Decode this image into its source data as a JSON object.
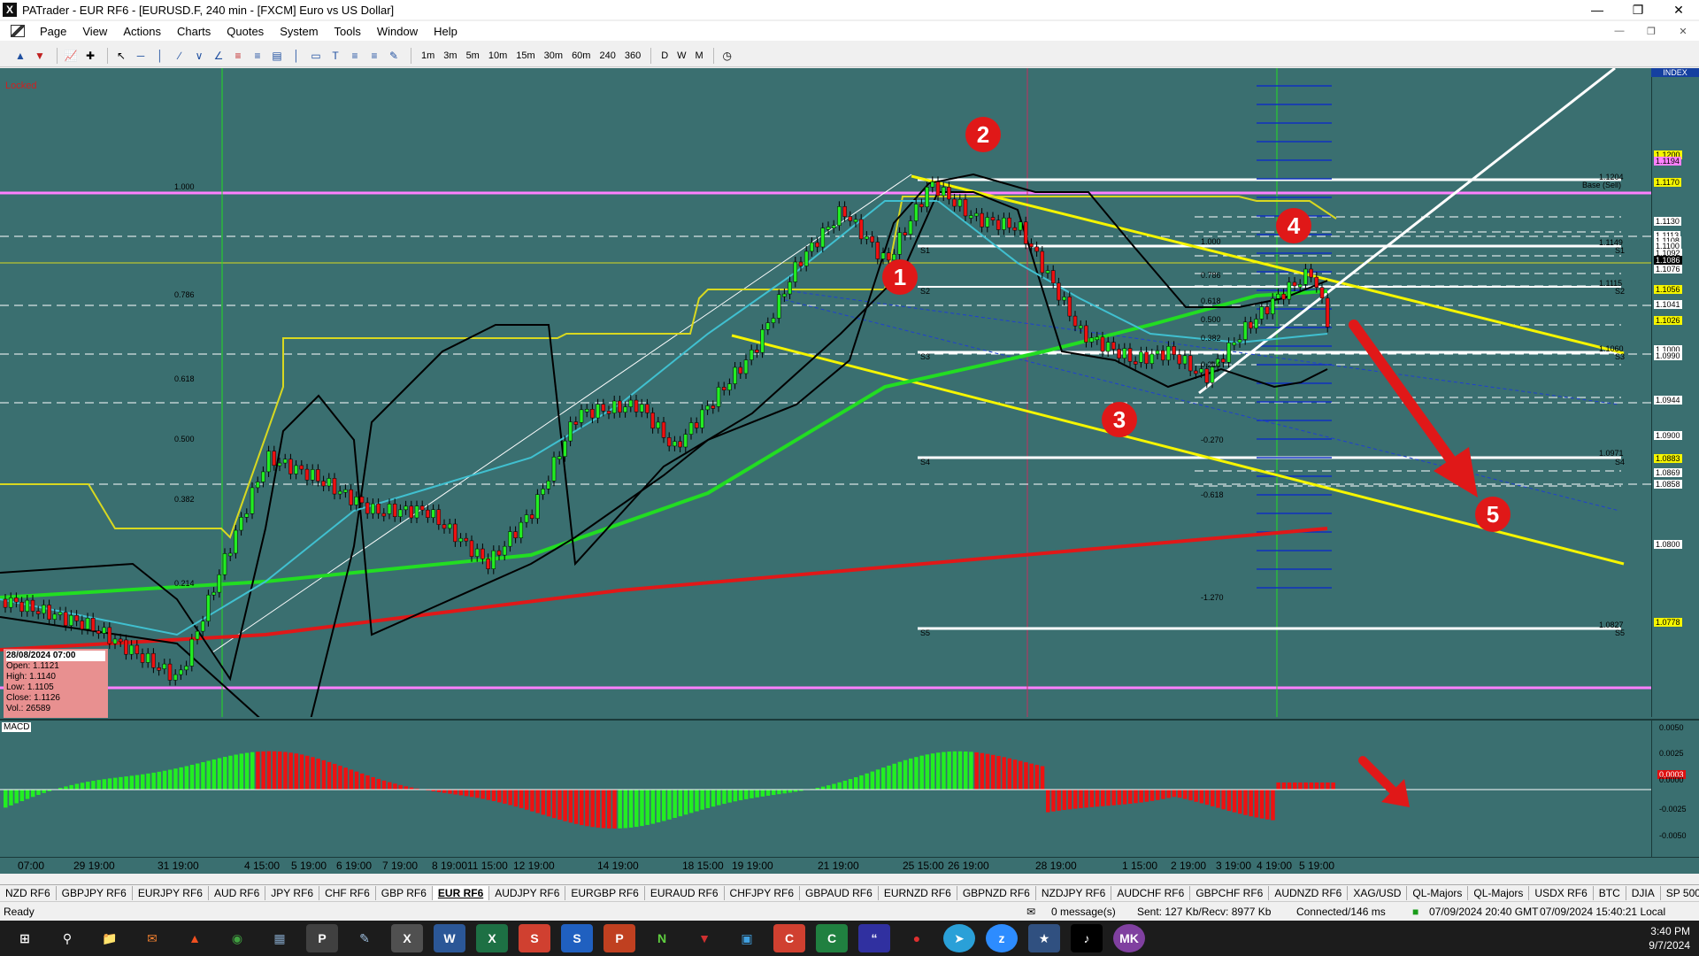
{
  "window": {
    "title": "PATrader - EUR RF6 - [EURUSD.F, 240 min - [FXCM] Euro vs US Dollar]"
  },
  "menu": [
    "Page",
    "View",
    "Actions",
    "Charts",
    "Quotes",
    "System",
    "Tools",
    "Window",
    "Help"
  ],
  "toolbar": {
    "timeframes": [
      "1m",
      "3m",
      "5m",
      "10m",
      "15m",
      "30m",
      "60m",
      "240",
      "360",
      "D",
      "W",
      "M"
    ]
  },
  "chart": {
    "locked_label": "Locked",
    "index_label": "INDEX",
    "macd_label": "MACD",
    "fib_left": [
      "1.000",
      "0.786",
      "0.618",
      "0.500",
      "0.382",
      "0.214"
    ],
    "fib_right": [
      "1.000",
      "0.786",
      "0.618",
      "0.500",
      "0.382",
      "0.214",
      "-0.270",
      "-0.618",
      "-1.270"
    ],
    "pivot_labels": [
      "S1",
      "S2",
      "S3",
      "S4",
      "S5"
    ],
    "right_level_labels": [
      "1.1204",
      "Base (Sell)",
      "1.1149",
      "S1",
      "1.1115",
      "S2",
      "1.1060",
      "S3",
      "1.0971",
      "S4",
      "1.0827",
      "S5"
    ],
    "price_scale": [
      "1.1200",
      "1.1194",
      "1.1170",
      "1.1130",
      "1.1113",
      "1.1108",
      "1.1100",
      "1.1092",
      "1.1086",
      "1.1076",
      "1.1056",
      "1.1041",
      "1.1026",
      "1.1000",
      "1.0990",
      "1.0944",
      "1.0900",
      "1.0883",
      "1.0869",
      "1.0858",
      "1.0800",
      "1.0778"
    ],
    "macd_scale": [
      "0.0050",
      "0.0025",
      "0.0003",
      "0.0000",
      "-0.0025",
      "-0.0050"
    ],
    "ohlc": {
      "date": "28/08/2024 07:00",
      "open": "Open: 1.1121",
      "high": "High: 1.1140",
      "low": "Low: 1.1105",
      "close": "Close: 1.1126",
      "vol": "Vol.: 26589"
    },
    "markers": [
      "1",
      "2",
      "3",
      "4",
      "5"
    ],
    "time_labels": [
      "07:00",
      "29 19:00",
      "31 19:00",
      "4 15:00",
      "5 19:00",
      "6 19:00",
      "7 19:00",
      "8 19:00",
      "11 15:00",
      "12 19:00",
      "14 19:00",
      "18 15:00",
      "19 19:00",
      "21 19:00",
      "25 15:00",
      "26 19:00",
      "28 19:00",
      "1 15:00",
      "2 19:00",
      "3 19:00",
      "4 19:00",
      "5 19:00"
    ]
  },
  "tabs": [
    "NZD RF6",
    "GBPJPY RF6",
    "EURJPY RF6",
    "AUD RF6",
    "JPY RF6",
    "CHF RF6",
    "GBP RF6",
    "EUR RF6",
    "AUDJPY RF6",
    "EURGBP RF6",
    "EURAUD RF6",
    "CHFJPY RF6",
    "GBPAUD RF6",
    "EURNZD RF6",
    "GBPNZD RF6",
    "NZDJPY RF6",
    "AUDCHF RF6",
    "GBPCHF RF6",
    "AUDNZD RF6",
    "XAG/USD",
    "QL-Majors",
    "QL-Majors",
    "USDX RF6",
    "BTC",
    "DJIA",
    "SP 500"
  ],
  "active_tab": "EUR RF6",
  "status": {
    "ready": "Ready",
    "messages": "0 message(s)",
    "traffic": "Sent: 127 Kb/Recv: 8977 Kb",
    "connection": "Connected/146 ms",
    "gmt": "07/09/2024 20:40 GMT",
    "local": "07/09/2024 15:40:21 Local"
  },
  "taskbar": {
    "time": "3:40 PM",
    "date": "9/7/2024",
    "avatar_initials": "MK"
  },
  "colors": {
    "chart_bg": "#3a6f70",
    "bull": "#22ee22",
    "bear": "#ee1111",
    "fib_channel": "#f5f500",
    "marker": "#e01818"
  }
}
